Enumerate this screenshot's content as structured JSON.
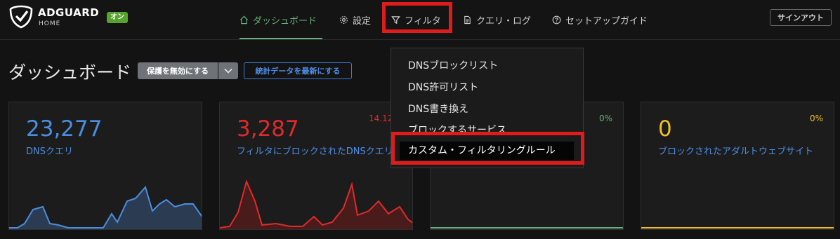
{
  "header": {
    "brand": "ADGUARD",
    "brand_sub": "HOME",
    "badge": "オン",
    "nav": [
      {
        "label": "ダッシュボード",
        "icon": "home-icon"
      },
      {
        "label": "設定",
        "icon": "gear-icon"
      },
      {
        "label": "フィルタ",
        "icon": "filter-icon"
      },
      {
        "label": "クエリ・ログ",
        "icon": "document-icon"
      },
      {
        "label": "セットアップガイド",
        "icon": "help-icon"
      }
    ],
    "signout": "サインアウト"
  },
  "page": {
    "title": "ダッシュボード",
    "protect_button": "保護を無効にする",
    "refresh_button": "統計データを最新にする"
  },
  "cards": [
    {
      "value": "23,277",
      "label": "DNSクエリ",
      "color": "#4a8ee0"
    },
    {
      "value": "3,287",
      "label": "フィルタにブロックされたDNSクエリ",
      "pct": "14.12",
      "color": "#e02a2a"
    },
    {
      "value": "",
      "label": "",
      "pct": "0%",
      "color": "#67b279"
    },
    {
      "value": "0",
      "label": "ブロックされたアダルトウェブサイト",
      "pct": "0%",
      "color": "#f0bf29"
    }
  ],
  "dropdown": {
    "items": [
      "DNSブロックリスト",
      "DNS許可リスト",
      "DNS書き換え",
      "ブロックするサービス"
    ],
    "selected": "カスタム・フィルタリングルール"
  },
  "colors": {
    "accent": "#67b279",
    "highlight": "#e01b1b",
    "link": "#4f8ee8"
  }
}
